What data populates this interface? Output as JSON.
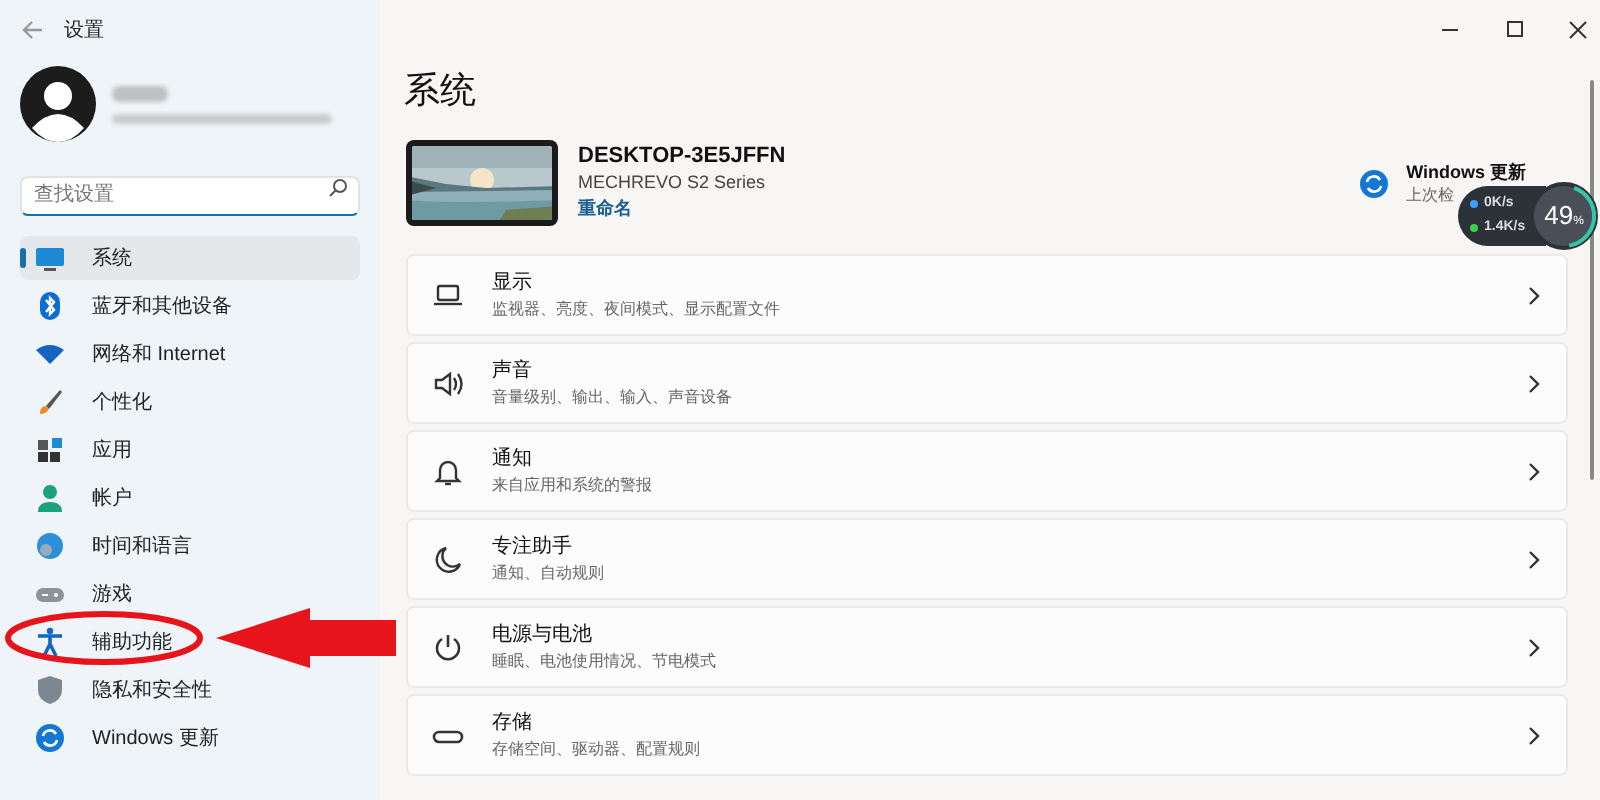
{
  "window": {
    "title": "设置"
  },
  "search": {
    "placeholder": "查找设置"
  },
  "sidebar": {
    "items": [
      {
        "label": "系统",
        "selected": true
      },
      {
        "label": "蓝牙和其他设备",
        "selected": false
      },
      {
        "label": "网络和 Internet",
        "selected": false
      },
      {
        "label": "个性化",
        "selected": false
      },
      {
        "label": "应用",
        "selected": false
      },
      {
        "label": "帐户",
        "selected": false
      },
      {
        "label": "时间和语言",
        "selected": false
      },
      {
        "label": "游戏",
        "selected": false
      },
      {
        "label": "辅助功能",
        "selected": false
      },
      {
        "label": "隐私和安全性",
        "selected": false
      },
      {
        "label": "Windows 更新",
        "selected": false
      }
    ]
  },
  "page_title": "系统",
  "device": {
    "name": "DESKTOP-3E5JFFN",
    "model": "MECHREVO S2 Series",
    "rename_link": "重命名"
  },
  "update": {
    "title": "Windows 更新",
    "subtitle": "上次检"
  },
  "net_widget": {
    "upload": "0K/s",
    "download": "1.4K/s",
    "percent": "49",
    "percent_unit": "%"
  },
  "settings": [
    {
      "title": "显示",
      "subtitle": "监视器、亮度、夜间模式、显示配置文件"
    },
    {
      "title": "声音",
      "subtitle": "音量级别、输出、输入、声音设备"
    },
    {
      "title": "通知",
      "subtitle": "来自应用和系统的警报"
    },
    {
      "title": "专注助手",
      "subtitle": "通知、自动规则"
    },
    {
      "title": "电源与电池",
      "subtitle": "睡眠、电池使用情况、节电模式"
    },
    {
      "title": "存储",
      "subtitle": "存储空间、驱动器、配置规则"
    }
  ]
}
